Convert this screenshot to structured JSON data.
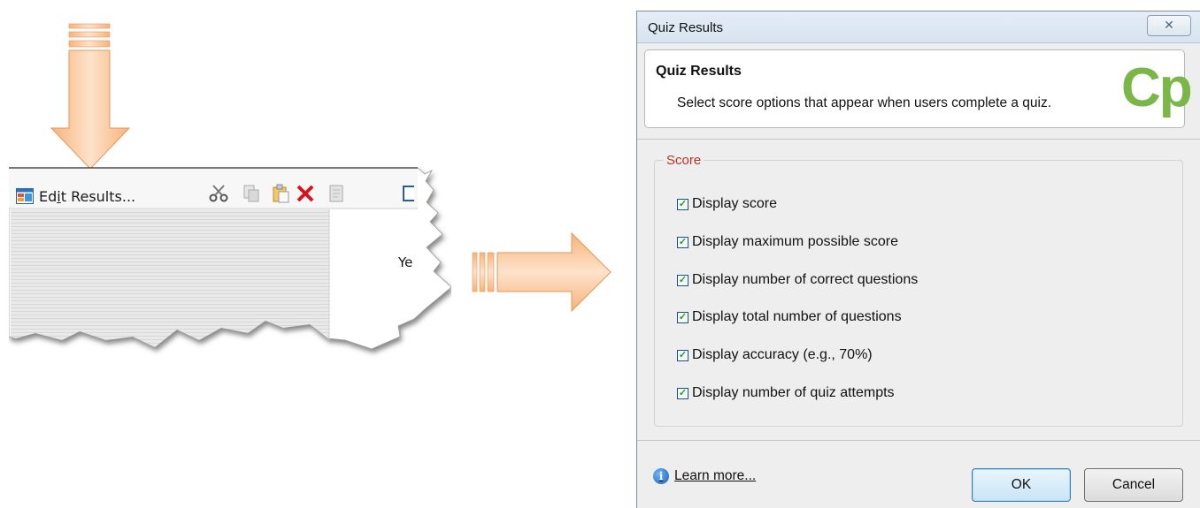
{
  "left_toolbar": {
    "edit_results_label": "Edit Results...",
    "edit_results_accel": "i",
    "cut_icon": "cut-icon",
    "copy_icon": "copy-icon",
    "paste_icon": "paste-icon",
    "delete_icon": "delete-icon",
    "duplicate_icon": "duplicate-icon",
    "truncated_text": "Ye"
  },
  "dialog": {
    "window_title": "Quiz Results",
    "close_glyph": "✕",
    "header_title": "Quiz Results",
    "header_subtitle": "Select score options that appear when users complete a quiz.",
    "logo_text": "Cp",
    "score_group_label": "Score",
    "options": [
      {
        "label": "Display score",
        "checked": true
      },
      {
        "label": "Display maximum possible score",
        "checked": true
      },
      {
        "label": "Display number of correct questions",
        "checked": true
      },
      {
        "label": "Display total number of questions",
        "checked": true
      },
      {
        "label": "Display accuracy (e.g., 70%)",
        "checked": true
      },
      {
        "label": "Display number of quiz attempts",
        "checked": true
      }
    ],
    "learn_more_label": "Learn more...",
    "ok_label": "OK",
    "cancel_label": "Cancel"
  },
  "colors": {
    "arrow_fill": "#f9c89a",
    "logo_green": "#7ab648",
    "score_label_red": "#b3332a"
  }
}
